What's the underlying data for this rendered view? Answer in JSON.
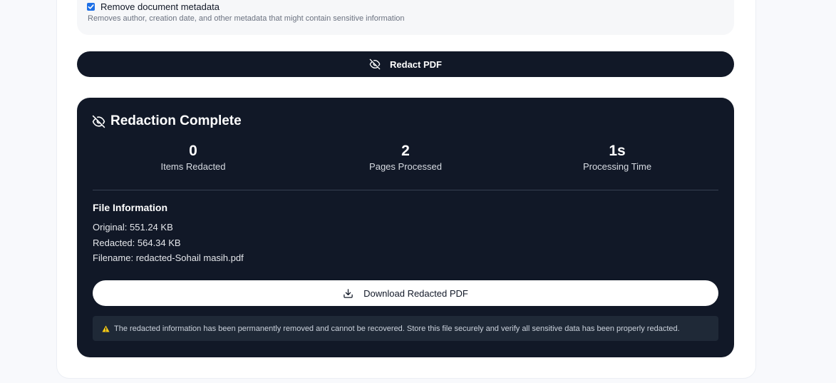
{
  "metadata_option": {
    "label": "Remove document metadata",
    "checked": true,
    "help": "Removes author, creation date, and other metadata that might contain sensitive information"
  },
  "redact_button": {
    "label": "Redact PDF",
    "icon": "eye-off-icon"
  },
  "result": {
    "title": "Redaction Complete",
    "icon": "eye-off-icon",
    "stats": [
      {
        "value": "0",
        "label": "Items Redacted"
      },
      {
        "value": "2",
        "label": "Pages Processed"
      },
      {
        "value": "1s",
        "label": "Processing Time"
      }
    ],
    "file_info": {
      "title": "File Information",
      "original": "Original: 551.24 KB",
      "redacted": "Redacted: 564.34 KB",
      "filename": "Filename: redacted-Sohail masih.pdf"
    },
    "download_button": {
      "label": "Download Redacted PDF",
      "icon": "download-icon"
    },
    "warning": {
      "icon": "warning-icon",
      "text": "The redacted information has been permanently removed and cannot be recovered. Store this file securely and verify all sensitive data has been properly redacted."
    }
  },
  "colors": {
    "dark": "#111827",
    "accent": "#1d6fe6",
    "warning": "#facc15"
  }
}
